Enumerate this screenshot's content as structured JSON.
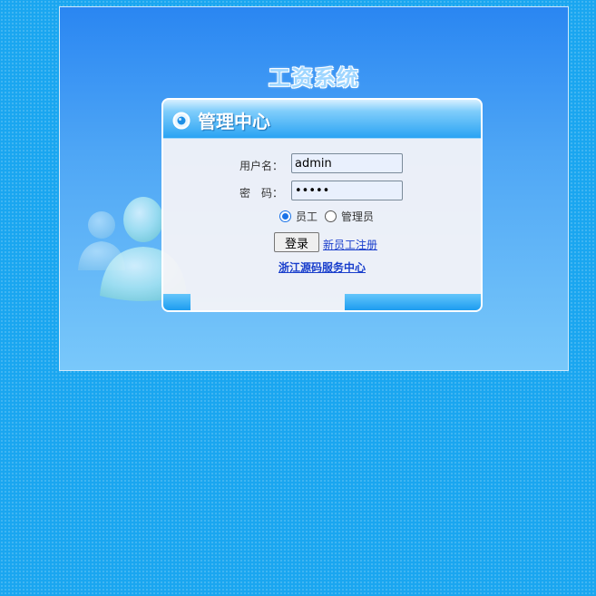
{
  "app": {
    "system_title": "工资系统"
  },
  "panel": {
    "title": "管理中心"
  },
  "form": {
    "username_label": "用户名：",
    "username_value": "admin",
    "password_label": "密　码：",
    "password_value": "admin",
    "role_options": [
      {
        "label": "员工",
        "selected": true
      },
      {
        "label": "管理员",
        "selected": false
      }
    ],
    "login_label": "登录",
    "register_label": "新员工注册"
  },
  "footer": {
    "service_center": "浙江源码服务中心"
  },
  "colors": {
    "page_bg": "#1aa6f0",
    "header_blue": "#2aa3f3",
    "link_blue": "#1a3fcc"
  },
  "icons": {
    "header": "radio-circle-icon",
    "decoration": "users-icon"
  }
}
